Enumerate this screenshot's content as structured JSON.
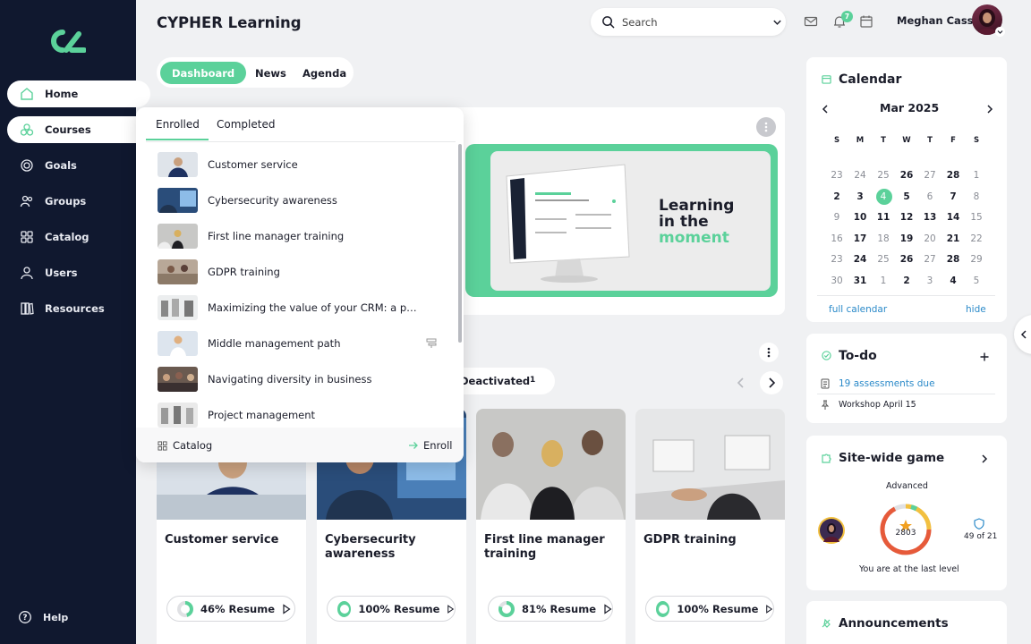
{
  "app": {
    "title": "CYPHER Learning"
  },
  "sidebar": {
    "items": [
      {
        "label": "Home",
        "icon": "home-icon"
      },
      {
        "label": "Courses",
        "icon": "courses-icon"
      },
      {
        "label": "Goals",
        "icon": "goals-icon"
      },
      {
        "label": "Groups",
        "icon": "groups-icon"
      },
      {
        "label": "Catalog",
        "icon": "catalog-icon"
      },
      {
        "label": "Users",
        "icon": "users-icon"
      },
      {
        "label": "Resources",
        "icon": "resources-icon"
      }
    ],
    "help": "Help"
  },
  "header": {
    "search_placeholder": "Search",
    "notifications_count": "7",
    "user_name": "Meghan Cass"
  },
  "tabs": [
    "Dashboard",
    "News",
    "Agenda"
  ],
  "banner": {
    "line1": "Learning",
    "line2": "in the",
    "line3": "moment"
  },
  "dropdown": {
    "tabs": [
      "Enrolled",
      "Completed"
    ],
    "items": [
      "Customer service",
      "Cybersecurity awareness",
      "First line manager training",
      "GDPR training",
      "Maximizing the value of your CRM: a post...",
      "Middle management path",
      "Navigating diversity in business",
      "Project management"
    ],
    "footer_catalog": "Catalog",
    "footer_enroll": "Enroll"
  },
  "courses_filter": {
    "label": "Deactivated",
    "count": "1"
  },
  "courses": [
    {
      "title": "Customer service",
      "progress": "46%",
      "resume": "Resume",
      "pct": 46
    },
    {
      "title": "Cybersecurity awareness",
      "progress": "100%",
      "resume": "Resume",
      "pct": 100
    },
    {
      "title": "First line manager training",
      "progress": "81%",
      "resume": "Resume",
      "pct": 81
    },
    {
      "title": "GDPR training",
      "progress": "100%",
      "resume": "Resume",
      "pct": 100
    }
  ],
  "calendar": {
    "title": "Calendar",
    "month": "Mar 2025",
    "weekdays": [
      "S",
      "M",
      "T",
      "W",
      "T",
      "F",
      "S"
    ],
    "weeks": [
      [
        "23",
        "24",
        "25",
        "26",
        "27",
        "28",
        "1"
      ],
      [
        "2",
        "3",
        "4",
        "5",
        "6",
        "7",
        "8"
      ],
      [
        "9",
        "10",
        "11",
        "12",
        "13",
        "14",
        "15"
      ],
      [
        "16",
        "17",
        "18",
        "19",
        "20",
        "21",
        "22"
      ],
      [
        "23",
        "24",
        "25",
        "26",
        "27",
        "28",
        "29"
      ],
      [
        "30",
        "31",
        "1",
        "2",
        "3",
        "4",
        "5"
      ]
    ],
    "full_calendar": "full calendar",
    "hide": "hide"
  },
  "todo": {
    "title": "To-do",
    "items": [
      "19 assessments due",
      "Workshop April 15"
    ]
  },
  "game": {
    "title": "Site-wide game",
    "level": "Advanced",
    "points": "2803",
    "rank": "49 of 21",
    "footer": "You are at the last level"
  },
  "announcements": {
    "title": "Announcements"
  },
  "colors": {
    "accent": "#5bd19a",
    "sidebar": "#10182f",
    "link": "#2b8ac9"
  }
}
